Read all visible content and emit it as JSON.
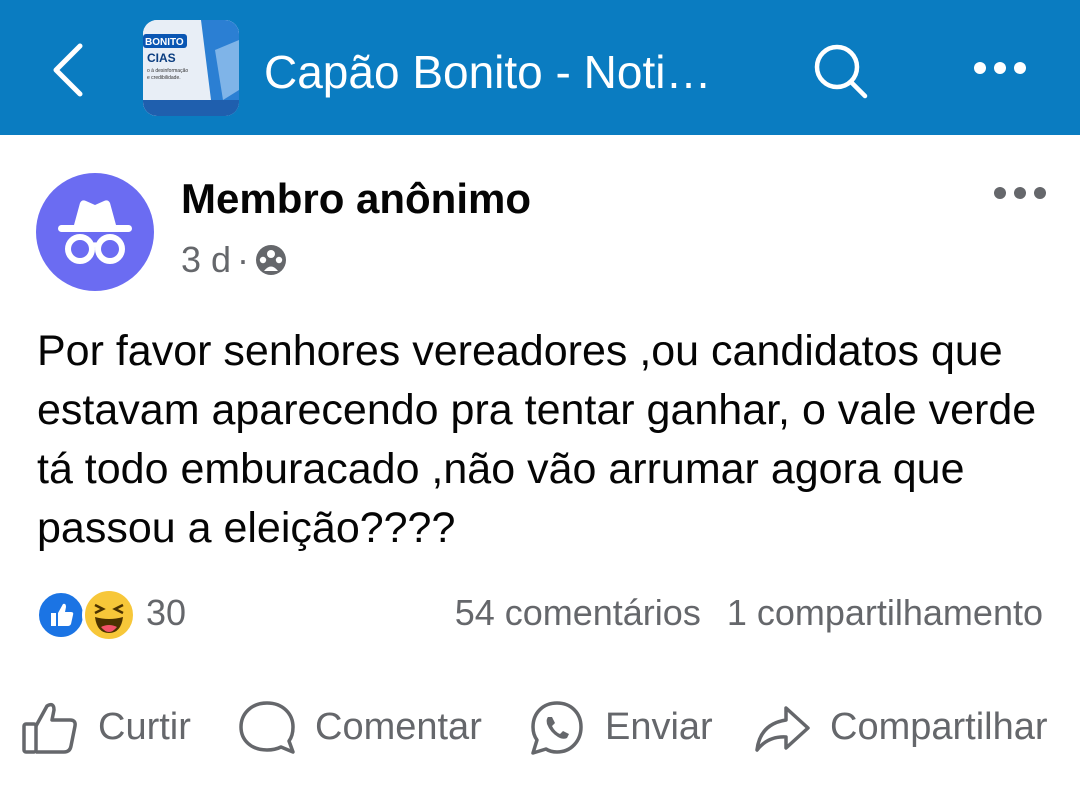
{
  "header": {
    "group_title": "Capão Bonito - Noti…",
    "thumb_text_1": "BONITO",
    "thumb_text_2": "CIAS",
    "thumb_text_3": "o à desinformação",
    "thumb_text_4": "e credibilidade.",
    "icons": [
      "back-arrow-icon",
      "search-icon",
      "more-icon"
    ],
    "bar_color": "#0a7cc1"
  },
  "post": {
    "author": "Membro anônimo",
    "time": "3 d",
    "separator": "·",
    "audience_icon": "group-icon",
    "avatar_icon": "anonymous-incognito-icon",
    "avatar_color": "#6b6cf2",
    "text": "Por favor senhores vereadores ,ou candidatos que estavam aparecendo pra tentar ganhar, o vale verde tá todo emburacado ,não vão arrumar agora que passou a eleição????"
  },
  "engagement": {
    "reaction_count": "30",
    "reaction_icons": [
      "like-reaction-icon",
      "haha-reaction-icon"
    ],
    "comments": "54 comentários",
    "shares": "1 compartilhamento"
  },
  "actions": {
    "like": "Curtir",
    "comment": "Comentar",
    "send": "Enviar",
    "share": "Compartilhar"
  }
}
